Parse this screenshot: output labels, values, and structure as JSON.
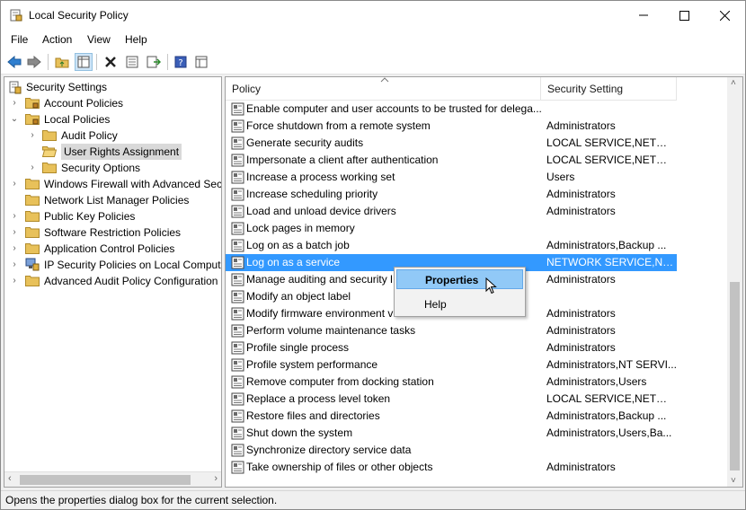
{
  "window": {
    "title": "Local Security Policy"
  },
  "menu": [
    "File",
    "Action",
    "View",
    "Help"
  ],
  "toolbar": [
    "back-icon",
    "forward-icon",
    "up-folder-icon",
    "show-hide-tree-icon",
    "delete-icon",
    "properties-icon",
    "export-icon",
    "help-icon",
    "details-view-icon"
  ],
  "tree": [
    {
      "label": "Security Settings",
      "expanded": true
    },
    {
      "label": "Account Policies",
      "expanded": false
    },
    {
      "label": "Local Policies",
      "expanded": true
    },
    {
      "label": "Audit Policy",
      "expanded": false
    },
    {
      "label": "User Rights Assignment",
      "selected": true
    },
    {
      "label": "Security Options",
      "expanded": false
    },
    {
      "label": "Windows Firewall with Advanced Secu",
      "expanded": false
    },
    {
      "label": "Network List Manager Policies"
    },
    {
      "label": "Public Key Policies",
      "expanded": false
    },
    {
      "label": "Software Restriction Policies",
      "expanded": false
    },
    {
      "label": "Application Control Policies",
      "expanded": false
    },
    {
      "label": "IP Security Policies on Local Compute",
      "expanded": false
    },
    {
      "label": "Advanced Audit Policy Configuration",
      "expanded": false
    }
  ],
  "list": {
    "columns": [
      "Policy",
      "Security Setting"
    ],
    "rows": [
      {
        "policy": "Enable computer and user accounts to be trusted for delega...",
        "setting": ""
      },
      {
        "policy": "Force shutdown from a remote system",
        "setting": "Administrators"
      },
      {
        "policy": "Generate security audits",
        "setting": "LOCAL SERVICE,NETWO..."
      },
      {
        "policy": "Impersonate a client after authentication",
        "setting": "LOCAL SERVICE,NETWO..."
      },
      {
        "policy": "Increase a process working set",
        "setting": "Users"
      },
      {
        "policy": "Increase scheduling priority",
        "setting": "Administrators"
      },
      {
        "policy": "Load and unload device drivers",
        "setting": "Administrators"
      },
      {
        "policy": "Lock pages in memory",
        "setting": ""
      },
      {
        "policy": "Log on as a batch job",
        "setting": "Administrators,Backup ..."
      },
      {
        "policy": "Log on as a service",
        "setting": "NETWORK SERVICE,NT ...",
        "selected": true
      },
      {
        "policy": "Manage auditing and security l",
        "setting": "Administrators"
      },
      {
        "policy": "Modify an object label",
        "setting": ""
      },
      {
        "policy": "Modify firmware environment v",
        "setting": "Administrators"
      },
      {
        "policy": "Perform volume maintenance tasks",
        "setting": "Administrators"
      },
      {
        "policy": "Profile single process",
        "setting": "Administrators"
      },
      {
        "policy": "Profile system performance",
        "setting": "Administrators,NT SERVI..."
      },
      {
        "policy": "Remove computer from docking station",
        "setting": "Administrators,Users"
      },
      {
        "policy": "Replace a process level token",
        "setting": "LOCAL SERVICE,NETWO..."
      },
      {
        "policy": "Restore files and directories",
        "setting": "Administrators,Backup ..."
      },
      {
        "policy": "Shut down the system",
        "setting": "Administrators,Users,Ba..."
      },
      {
        "policy": "Synchronize directory service data",
        "setting": ""
      },
      {
        "policy": "Take ownership of files or other objects",
        "setting": "Administrators"
      }
    ]
  },
  "context_menu": {
    "items": [
      "Properties",
      "Help"
    ]
  },
  "status": {
    "text": "Opens the properties dialog box for the current selection."
  },
  "colors": {
    "selection": "#3399ff",
    "menu_highlight": "#91c9f7",
    "folder": "#e8c15a"
  }
}
